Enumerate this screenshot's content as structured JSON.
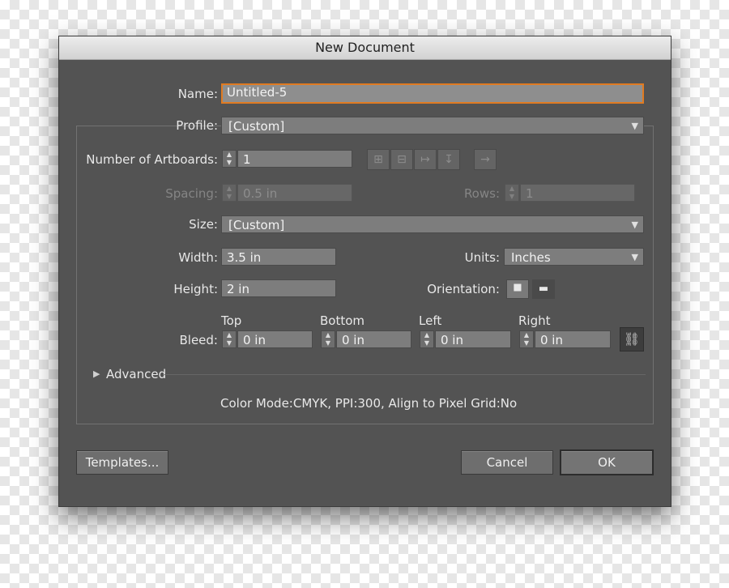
{
  "dialog": {
    "title": "New Document"
  },
  "name": {
    "label": "Name:",
    "value": "Untitled-5"
  },
  "profile": {
    "label": "Profile:",
    "value": "[Custom]"
  },
  "artboards": {
    "label": "Number of Artboards:",
    "value": "1",
    "arrangement_icons": [
      "grid-by-row-icon",
      "grid-by-column-icon",
      "arrange-by-row-icon",
      "arrange-by-column-icon",
      "right-to-left-icon"
    ]
  },
  "spacing": {
    "label": "Spacing:",
    "value": "0.5 in"
  },
  "rows": {
    "label": "Rows:",
    "value": "1"
  },
  "size": {
    "label": "Size:",
    "value": "[Custom]"
  },
  "width": {
    "label": "Width:",
    "value": "3.5 in"
  },
  "height": {
    "label": "Height:",
    "value": "2 in"
  },
  "units": {
    "label": "Units:",
    "value": "Inches"
  },
  "orientation": {
    "label": "Orientation:",
    "options": [
      "portrait-icon",
      "landscape-icon"
    ],
    "selected": "landscape-icon"
  },
  "bleed": {
    "label": "Bleed:",
    "top": {
      "label": "Top",
      "value": "0 in"
    },
    "bottom": {
      "label": "Bottom",
      "value": "0 in"
    },
    "left": {
      "label": "Left",
      "value": "0 in"
    },
    "right": {
      "label": "Right",
      "value": "0 in"
    },
    "link_icon": "link-icon"
  },
  "advanced": {
    "label": "Advanced"
  },
  "summary": "Color Mode:CMYK, PPI:300, Align to Pixel Grid:No",
  "buttons": {
    "templates": "Templates...",
    "cancel": "Cancel",
    "ok": "OK"
  },
  "colors": {
    "dialog_bg": "#535353",
    "field_bg": "#7d7d7d",
    "focus_ring": "#e07b22",
    "text": "#e8e8e8"
  }
}
